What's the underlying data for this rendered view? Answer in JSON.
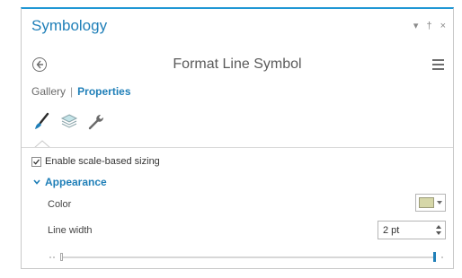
{
  "pane": {
    "title": "Symbology",
    "controls": {
      "menu": "▾",
      "pin": "†",
      "close": "×"
    }
  },
  "header": {
    "title": "Format Line Symbol",
    "back_icon": "back-arrow-icon",
    "menu_icon": "hamburger-icon"
  },
  "nav": {
    "gallery": "Gallery",
    "separator": "|",
    "properties": "Properties"
  },
  "tabs": [
    {
      "name": "symbol",
      "icon": "paintbrush-icon"
    },
    {
      "name": "layers",
      "icon": "layers-icon"
    },
    {
      "name": "structure",
      "icon": "wrench-icon"
    }
  ],
  "scale_sizing": {
    "label": "Enable scale-based sizing",
    "checked": true
  },
  "appearance": {
    "heading": "Appearance",
    "color_label": "Color",
    "color_value": "#d6d7a8",
    "line_width_label": "Line width",
    "line_width_value": "2 pt"
  },
  "colors": {
    "accent": "#1f7fb8",
    "border_top": "#1f97d4"
  }
}
